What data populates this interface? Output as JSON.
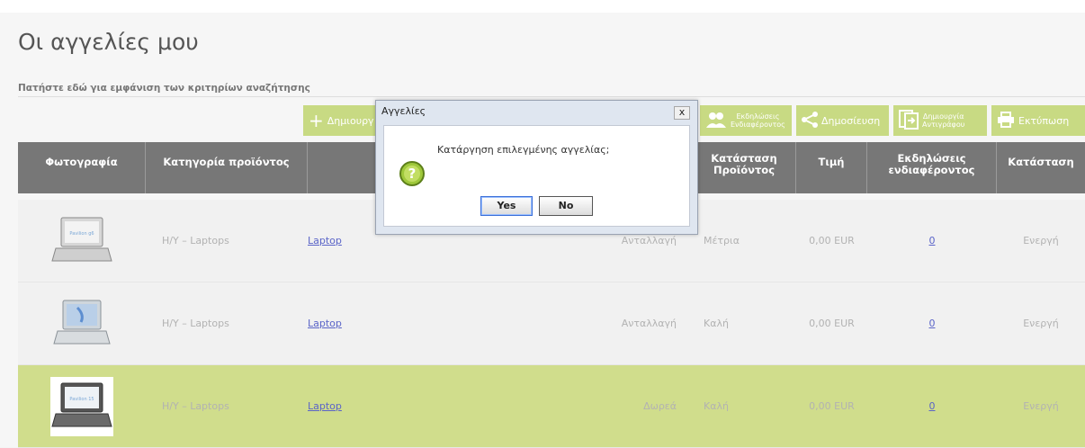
{
  "page": {
    "title": "Οι αγγελίες μου",
    "search_toggle": "Πατήστε εδώ για εμφάνιση των κριτηρίων αναζήτησης"
  },
  "toolbar": {
    "create": "Δημιουργ",
    "interest": [
      "Εκδηλώσεις",
      "Ενδιαφέροντος"
    ],
    "publish": "Δημοσίευση",
    "copy": [
      "Δημιουργία",
      "Αντιγράφου"
    ],
    "print": "Εκτύπωση"
  },
  "table": {
    "headers": {
      "photo": "Φωτογραφία",
      "category": "Κατηγορία προϊόντος",
      "condition": [
        "Κατάσταση",
        "Προϊόντος"
      ],
      "price": "Τιμή",
      "interest": [
        "Εκδηλώσεις",
        "ενδιαφέροντος"
      ],
      "status": "Κατάσταση"
    },
    "rows": [
      {
        "category": "H/Y – Laptops",
        "title": "Laptop",
        "type": "Ανταλλαγή",
        "condition": "Μέτρια",
        "price": "0,00 EUR",
        "interest": "0",
        "status": "Ενεργή",
        "thumb_label": "Pavilion g6"
      },
      {
        "category": "H/Y – Laptops",
        "title": "Laptop",
        "type": "Ανταλλαγή",
        "condition": "Καλή",
        "price": "0,00 EUR",
        "interest": "0",
        "status": "Ενεργή"
      },
      {
        "category": "H/Y – Laptops",
        "title": "Laptop",
        "type": "Δωρεά",
        "condition": "Καλή",
        "price": "0,00 EUR",
        "interest": "0",
        "status": "Ενεργή",
        "thumb_label": "Pavilion 15"
      }
    ]
  },
  "dialog": {
    "title": "Αγγελίες",
    "close": "x",
    "message": "Κατάργηση επιλεγμένης αγγελίας;",
    "yes": "Yes",
    "no": "No"
  },
  "colors": {
    "accent": "#c8da83",
    "header": "#777777",
    "selected_row": "#d0dd8c",
    "link": "#5a64c8"
  }
}
